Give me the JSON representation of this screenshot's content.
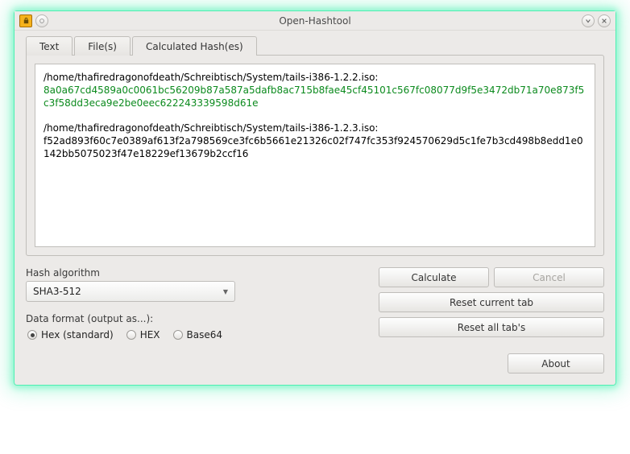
{
  "window": {
    "title": "Open-Hashtool"
  },
  "tabs": {
    "text": "Text",
    "files": "File(s)",
    "calculated": "Calculated Hash(es)"
  },
  "results": {
    "entry1_path": "/home/thafiredragonofdeath/Schreibtisch/System/tails-i386-1.2.2.iso:",
    "entry1_hash": "8a0a67cd4589a0c0061bc56209b87a587a5dafb8ac715b8fae45cf45101c567fc08077d9f5e3472db71a70e873f5c3f58dd3eca9e2be0eec622243339598d61e",
    "entry2_path": "/home/thafiredragonofdeath/Schreibtisch/System/tails-i386-1.2.3.iso:",
    "entry2_hash": "f52ad893f60c7e0389af613f2a798569ce3fc6b5661e21326c02f747fc353f924570629d5c1fe7b3cd498b8edd1e0142bb5075023f47e18229ef13679b2ccf16"
  },
  "algo": {
    "label": "Hash algorithm",
    "value": "SHA3-512"
  },
  "format": {
    "label": "Data format (output as...):",
    "opt_hex_std": "Hex (standard)",
    "opt_hex_up": "HEX",
    "opt_base64": "Base64"
  },
  "buttons": {
    "calculate": "Calculate",
    "cancel": "Cancel",
    "reset_current": "Reset current tab",
    "reset_all": "Reset all tab's",
    "about": "About"
  }
}
